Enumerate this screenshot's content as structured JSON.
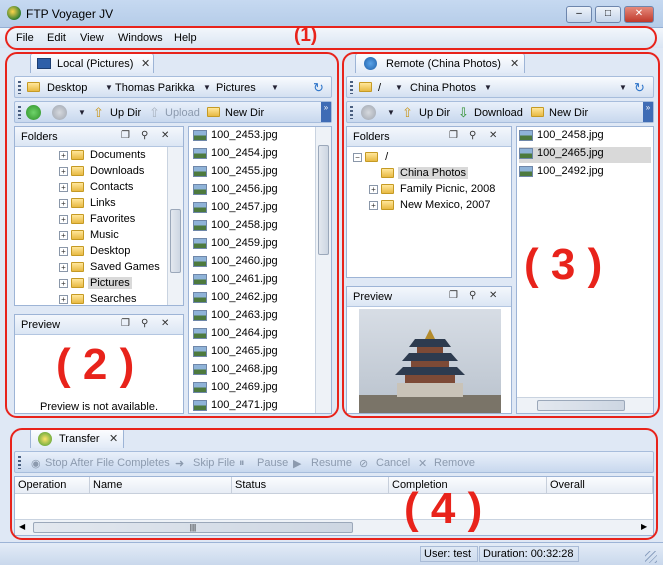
{
  "window": {
    "title": "FTP Voyager JV"
  },
  "menu": [
    "File",
    "Edit",
    "View",
    "Windows",
    "Help"
  ],
  "annotations": {
    "one": "(1)",
    "two": "( 2 )",
    "three": "( 3 )",
    "four": "( 4 )"
  },
  "local": {
    "tab_label": "Local (Pictures)",
    "path": [
      "Desktop",
      "Thomas Parikka",
      "Pictures"
    ],
    "toolbar": {
      "up_dir": "Up Dir",
      "upload": "Upload",
      "new_dir": "New Dir"
    },
    "folders_title": "Folders",
    "folders": [
      {
        "name": "Documents",
        "selected": false
      },
      {
        "name": "Downloads",
        "selected": false
      },
      {
        "name": "Contacts",
        "selected": false
      },
      {
        "name": "Links",
        "selected": false
      },
      {
        "name": "Favorites",
        "selected": false
      },
      {
        "name": "Music",
        "selected": false
      },
      {
        "name": "Desktop",
        "selected": false
      },
      {
        "name": "Saved Games",
        "selected": false
      },
      {
        "name": "Pictures",
        "selected": true
      },
      {
        "name": "Searches",
        "selected": false
      }
    ],
    "preview_title": "Preview",
    "preview_message": "Preview is not available.",
    "files": [
      "100_2453.jpg",
      "100_2454.jpg",
      "100_2455.jpg",
      "100_2456.jpg",
      "100_2457.jpg",
      "100_2458.jpg",
      "100_2459.jpg",
      "100_2460.jpg",
      "100_2461.jpg",
      "100_2462.jpg",
      "100_2463.jpg",
      "100_2464.jpg",
      "100_2465.jpg",
      "100_2468.jpg",
      "100_2469.jpg",
      "100_2471.jpg"
    ]
  },
  "remote": {
    "tab_label": "Remote (China Photos)",
    "path": [
      "/",
      "China Photos"
    ],
    "toolbar": {
      "up_dir": "Up Dir",
      "download": "Download",
      "new_dir": "New Dir"
    },
    "folders_title": "Folders",
    "tree": {
      "root": "/",
      "children": [
        {
          "name": "China Photos",
          "selected": true
        },
        {
          "name": "Family Picnic, 2008",
          "selected": false
        },
        {
          "name": "New Mexico, 2007",
          "selected": false
        }
      ]
    },
    "preview_title": "Preview",
    "files": [
      {
        "name": "100_2458.jpg",
        "selected": false
      },
      {
        "name": "100_2465.jpg",
        "selected": true
      },
      {
        "name": "100_2492.jpg",
        "selected": false
      }
    ]
  },
  "transfer": {
    "tab_label": "Transfer",
    "toolbar": [
      "Stop After File Completes",
      "Skip File",
      "Pause",
      "Resume",
      "Cancel",
      "Remove"
    ],
    "columns": [
      "Operation",
      "Name",
      "Status",
      "Completion",
      "Overall"
    ]
  },
  "status": {
    "user": "User:  test",
    "duration": "Duration:  00:32:28"
  },
  "colors": {
    "annotation": "#e8231b",
    "selection": "#d9d9d9"
  }
}
